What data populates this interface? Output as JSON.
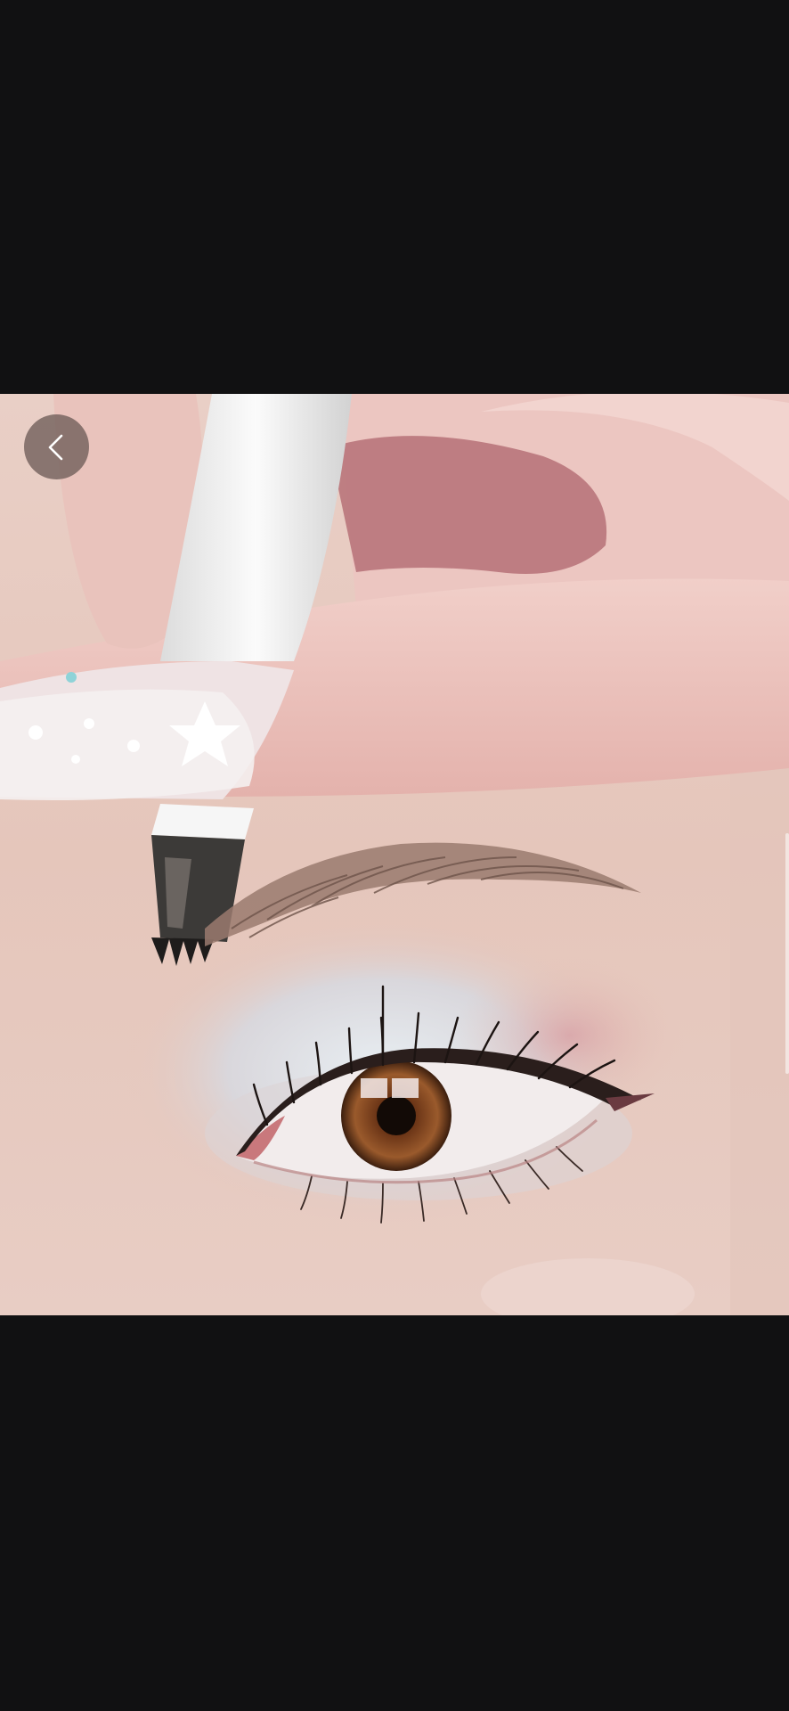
{
  "screen": {
    "background": "#111112"
  },
  "video": {
    "state": "playing",
    "content": "eyebrow-pen-tutorial"
  },
  "back_button": {
    "icon": "chevron-left-icon",
    "color": "#6e5c58"
  }
}
